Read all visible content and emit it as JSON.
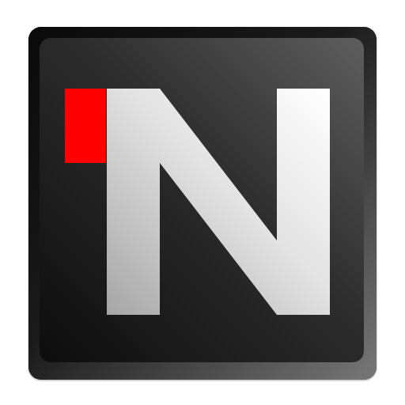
{
  "icon": {
    "name": "n-logo-icon",
    "glyph_text": "N",
    "colors": {
      "frame_dark": "#0a0a0a",
      "frame_light": "#777777",
      "face_top": "#5e5e5e",
      "face_bottom": "#0d0d0d",
      "letter_light": "#ffffff",
      "letter_shadow": "#a6a6a6",
      "accent": "#ff0000"
    }
  }
}
